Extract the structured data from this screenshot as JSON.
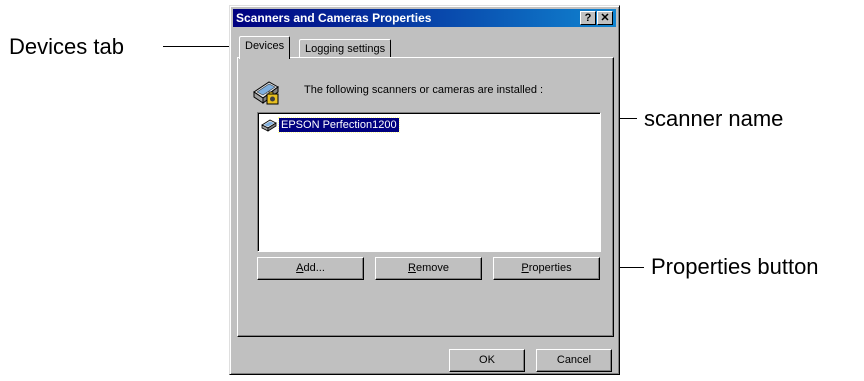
{
  "window": {
    "title": "Scanners and Cameras Properties",
    "help_label": "?",
    "close_label": "✕"
  },
  "tabs": [
    {
      "label": "Devices"
    },
    {
      "label": "Logging settings"
    }
  ],
  "devices_panel": {
    "install_text": "The following scanners or cameras are installed :",
    "devices": [
      {
        "name": "EPSON Perfection1200",
        "selected": true
      }
    ],
    "buttons": {
      "add": {
        "label": "Add...",
        "mnemonic": "A",
        "rest": "dd..."
      },
      "remove": {
        "label": "Remove",
        "mnemonic": "R",
        "rest": "emove"
      },
      "properties": {
        "label": "Properties",
        "mnemonic": "P",
        "rest": "roperties"
      }
    }
  },
  "footer": {
    "ok_label": "OK",
    "cancel_label": "Cancel"
  },
  "callouts": {
    "devices_tab": "Devices tab",
    "scanner_name": "scanner name",
    "properties_button": "Properties button"
  },
  "colors": {
    "titlebar_start": "#000080",
    "titlebar_end": "#1084d0",
    "face": "#c0c0c0",
    "selection": "#000080"
  }
}
